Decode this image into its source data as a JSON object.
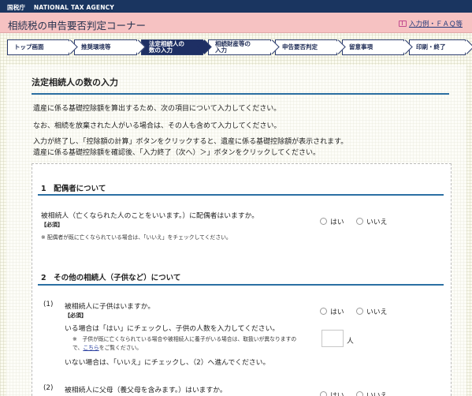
{
  "agency": {
    "name_jp": "国税庁",
    "name_en": "NATIONAL TAX AGENCY"
  },
  "title": "相続税の申告要否判定コーナー",
  "faq_link": "入力例・ＦＡＱ等",
  "steps": [
    {
      "label": "トップ画面"
    },
    {
      "label": "推奨環境等"
    },
    {
      "label": "法定相続人の\n数の入力"
    },
    {
      "label": "相続財産等の\n入力"
    },
    {
      "label": "申告要否判定"
    },
    {
      "label": "留意事項"
    },
    {
      "label": "印刷・終了"
    }
  ],
  "page_heading": "法定相続人の数の入力",
  "intro": {
    "line1": "遺産に係る基礎控除額を算出するため、次の項目について入力してください。",
    "line2": "なお、相続を放棄された人がいる場合は、その人も含めて入力してください。",
    "line3": "入力が終了し、「控除額の計算」ボタンをクリックすると、遺産に係る基礎控除額が表示されます。",
    "line4": "遺産に係る基礎控除額を確認後、「入力終了（次へ）＞」ボタンをクリックしてください。"
  },
  "section1": {
    "heading": "1　配偶者について",
    "question": "被相続人（亡くなられた人のことをいいます。）に配偶者はいますか。",
    "required": "【必須】",
    "note": "※  配偶者が既に亡くなられている場合は、「いいえ」をチェックしてください。",
    "yes": "はい",
    "no": "いいえ"
  },
  "section2": {
    "heading": "2　その他の相続人（子供など）について",
    "q1_num": "(1)",
    "q1_text": "被相続人に子供はいますか。",
    "q1_required": "【必須】",
    "q1_yes_instruction": "いる場合は「はい」にチェックし、子供の人数を入力してください。",
    "q1_note_line1": "※　子供が既に亡くなられている場合や被相続人に養子がいる場合は、取扱いが異なりますの",
    "q1_note_line2_pre": "で、",
    "q1_note_link": "こちら",
    "q1_note_line2_post": "をご覧ください。",
    "q1_no_instruction": "いない場合は、「いいえ」にチェックし、（2）へ進んでください。",
    "q1_unit": "人",
    "q2_num": "(2)",
    "q2_text": "被相続人に父母（養父母を含みます。）はいますか。",
    "yes": "はい",
    "no": "いいえ"
  },
  "colors": {
    "agency_bar": "#1a3560",
    "title_bar": "#f6c2c2",
    "step_active": "#1e2f64",
    "rule": "#2b6fa3"
  }
}
